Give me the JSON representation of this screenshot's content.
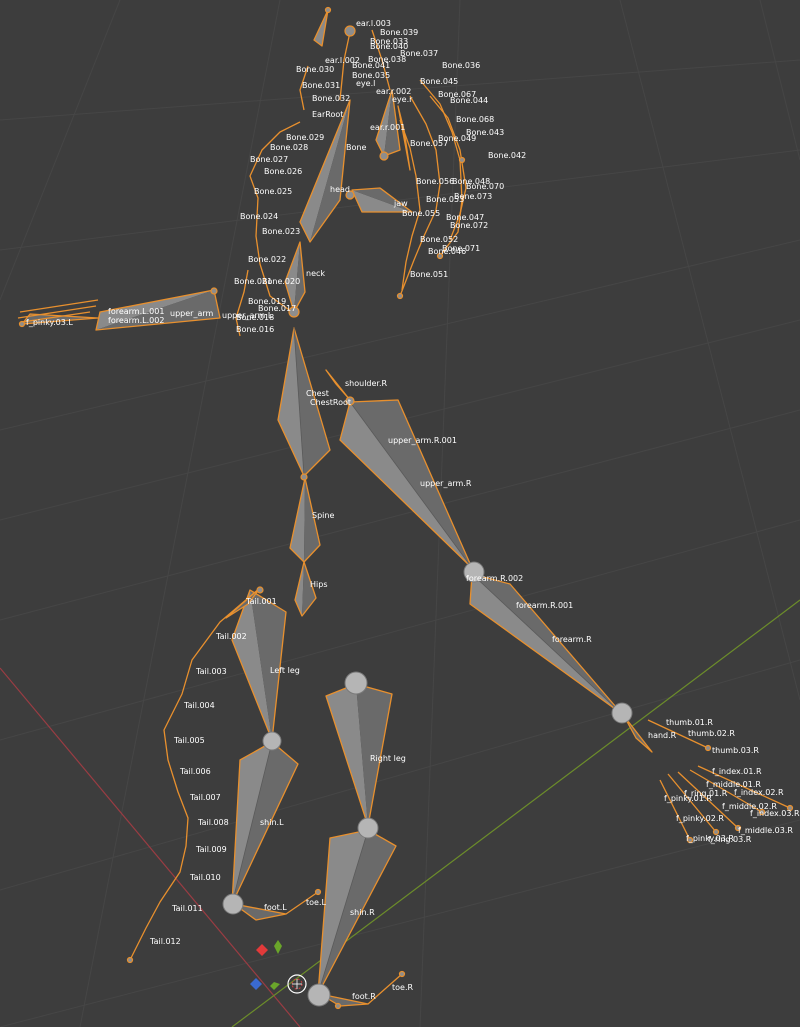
{
  "viewport": {
    "background": "#3d3d3d",
    "bone_outline_color": "#e8902e",
    "axis_x_color": "#9a3c43",
    "axis_y_color": "#6c8d2a"
  },
  "gizmo": {
    "icon": "view-gizmo-icon"
  },
  "bones": {
    "ear_l_003": "ear.l.003",
    "bone_039": "Bone.039",
    "bone_033": "Bone.033",
    "bone_040": "Bone.040",
    "bone_037": "Bone.037",
    "ear_l_002": "ear.l.002",
    "bone_038": "Bone.038",
    "bone_036": "Bone.036",
    "bone_030": "Bone.030",
    "bone_041": "Bone.041",
    "bone_035": "Bone.035",
    "bone_045": "Bone.045",
    "bone_031": "Bone.031",
    "eye_l": "eye.l",
    "ear_r_002": "ear.r.002",
    "bone_067": "Bone.067",
    "bone_032": "Bone.032",
    "eye_r": "eye.r",
    "bone_044": "Bone.044",
    "ear_root": "EarRoot",
    "bone_068": "Bone.068",
    "ear_r_001": "ear.r.001",
    "bone_043": "Bone.043",
    "bone_029": "Bone.029",
    "bone_057": "Bone.057",
    "bone_049": "Bone.049",
    "bone_028": "Bone.028",
    "bone": "Bone",
    "bone_042": "Bone.042",
    "bone_027": "Bone.027",
    "bone_026": "Bone.026",
    "bone_056": "Bone.056",
    "bone_048": "Bone.048",
    "bone_070": "Bone.070",
    "head": "head",
    "bone_025": "Bone.025",
    "bone_073": "Bone.073",
    "jaw": "jaw",
    "bone_053": "Bone.053",
    "bone_024": "Bone.024",
    "bone_055": "Bone.055",
    "bone_047": "Bone.047",
    "bone_072": "Bone.072",
    "bone_023": "Bone.023",
    "bone_052": "Bone.052",
    "bone_071": "Bone.071",
    "bone_046": "Bone.046",
    "bone_022": "Bone.022",
    "bone_051": "Bone.051",
    "neck": "neck",
    "bone_021": "Bone.021",
    "bone_020": "Bone.020",
    "bone_019": "Bone.019",
    "bone_017": "Bone.017",
    "forearm_l_001": "forearm.L.001",
    "upper_arm": "upper_arm",
    "upper_arm_l": "upper_arm.L",
    "forearm_l_002": "forearm.L.002",
    "bone_018": "Bone.018",
    "bone_016": "Bone.016",
    "f_pinky_03_l": "f_pinky.03.L",
    "chest": "Chest",
    "chest_root": "ChestRoot",
    "shoulder_r": "shoulder.R",
    "upper_arm_r_001": "upper_arm.R.001",
    "upper_arm_r": "upper_arm.R",
    "spine": "Spine",
    "forearm_r_002": "forearm.R.002",
    "forearm_r_001": "forearm.R.001",
    "hips": "Hips",
    "tail_001": "Tail.001",
    "tail_002": "Tail.002",
    "forearm_r": "forearm.R",
    "left_leg": "Left leg",
    "tail_003": "Tail.003",
    "tail_004": "Tail.004",
    "thumb_01_r": "thumb.01.R",
    "hand_r": "hand.R",
    "thumb_02_r": "thumb.02.R",
    "tail_005": "Tail.005",
    "right_leg": "Right leg",
    "thumb_03_r": "thumb.03.R",
    "tail_006": "Tail.006",
    "f_index_01_r": "f_index.01.R",
    "f_middle_01_r": "f_middle.01.R",
    "f_ring_01_r": "f_ring.01.R",
    "f_index_02_r": "f_index.02.R",
    "f_pinky_01_r": "f_pinky.01.R",
    "tail_007": "Tail.007",
    "f_middle_02_r": "f_middle.02.R",
    "f_index_03_r": "f_index.03.R",
    "tail_008": "Tail.008",
    "shin_l": "shin.L",
    "f_pinky_02_r": "f_pinky.02.R",
    "f_middle_03_r": "f_middle.03.R",
    "tail_009": "Tail.009",
    "f_pinky_03_r": "f_pinky.03.R",
    "f_ring_03_r": "f_ring.03.R",
    "tail_010": "Tail.010",
    "tail_011": "Tail.011",
    "foot_l": "foot.L",
    "toe_l": "toe.L",
    "shin_r": "shin.R",
    "tail_012": "Tail.012",
    "foot_r": "foot.R",
    "toe_r": "toe.R"
  }
}
